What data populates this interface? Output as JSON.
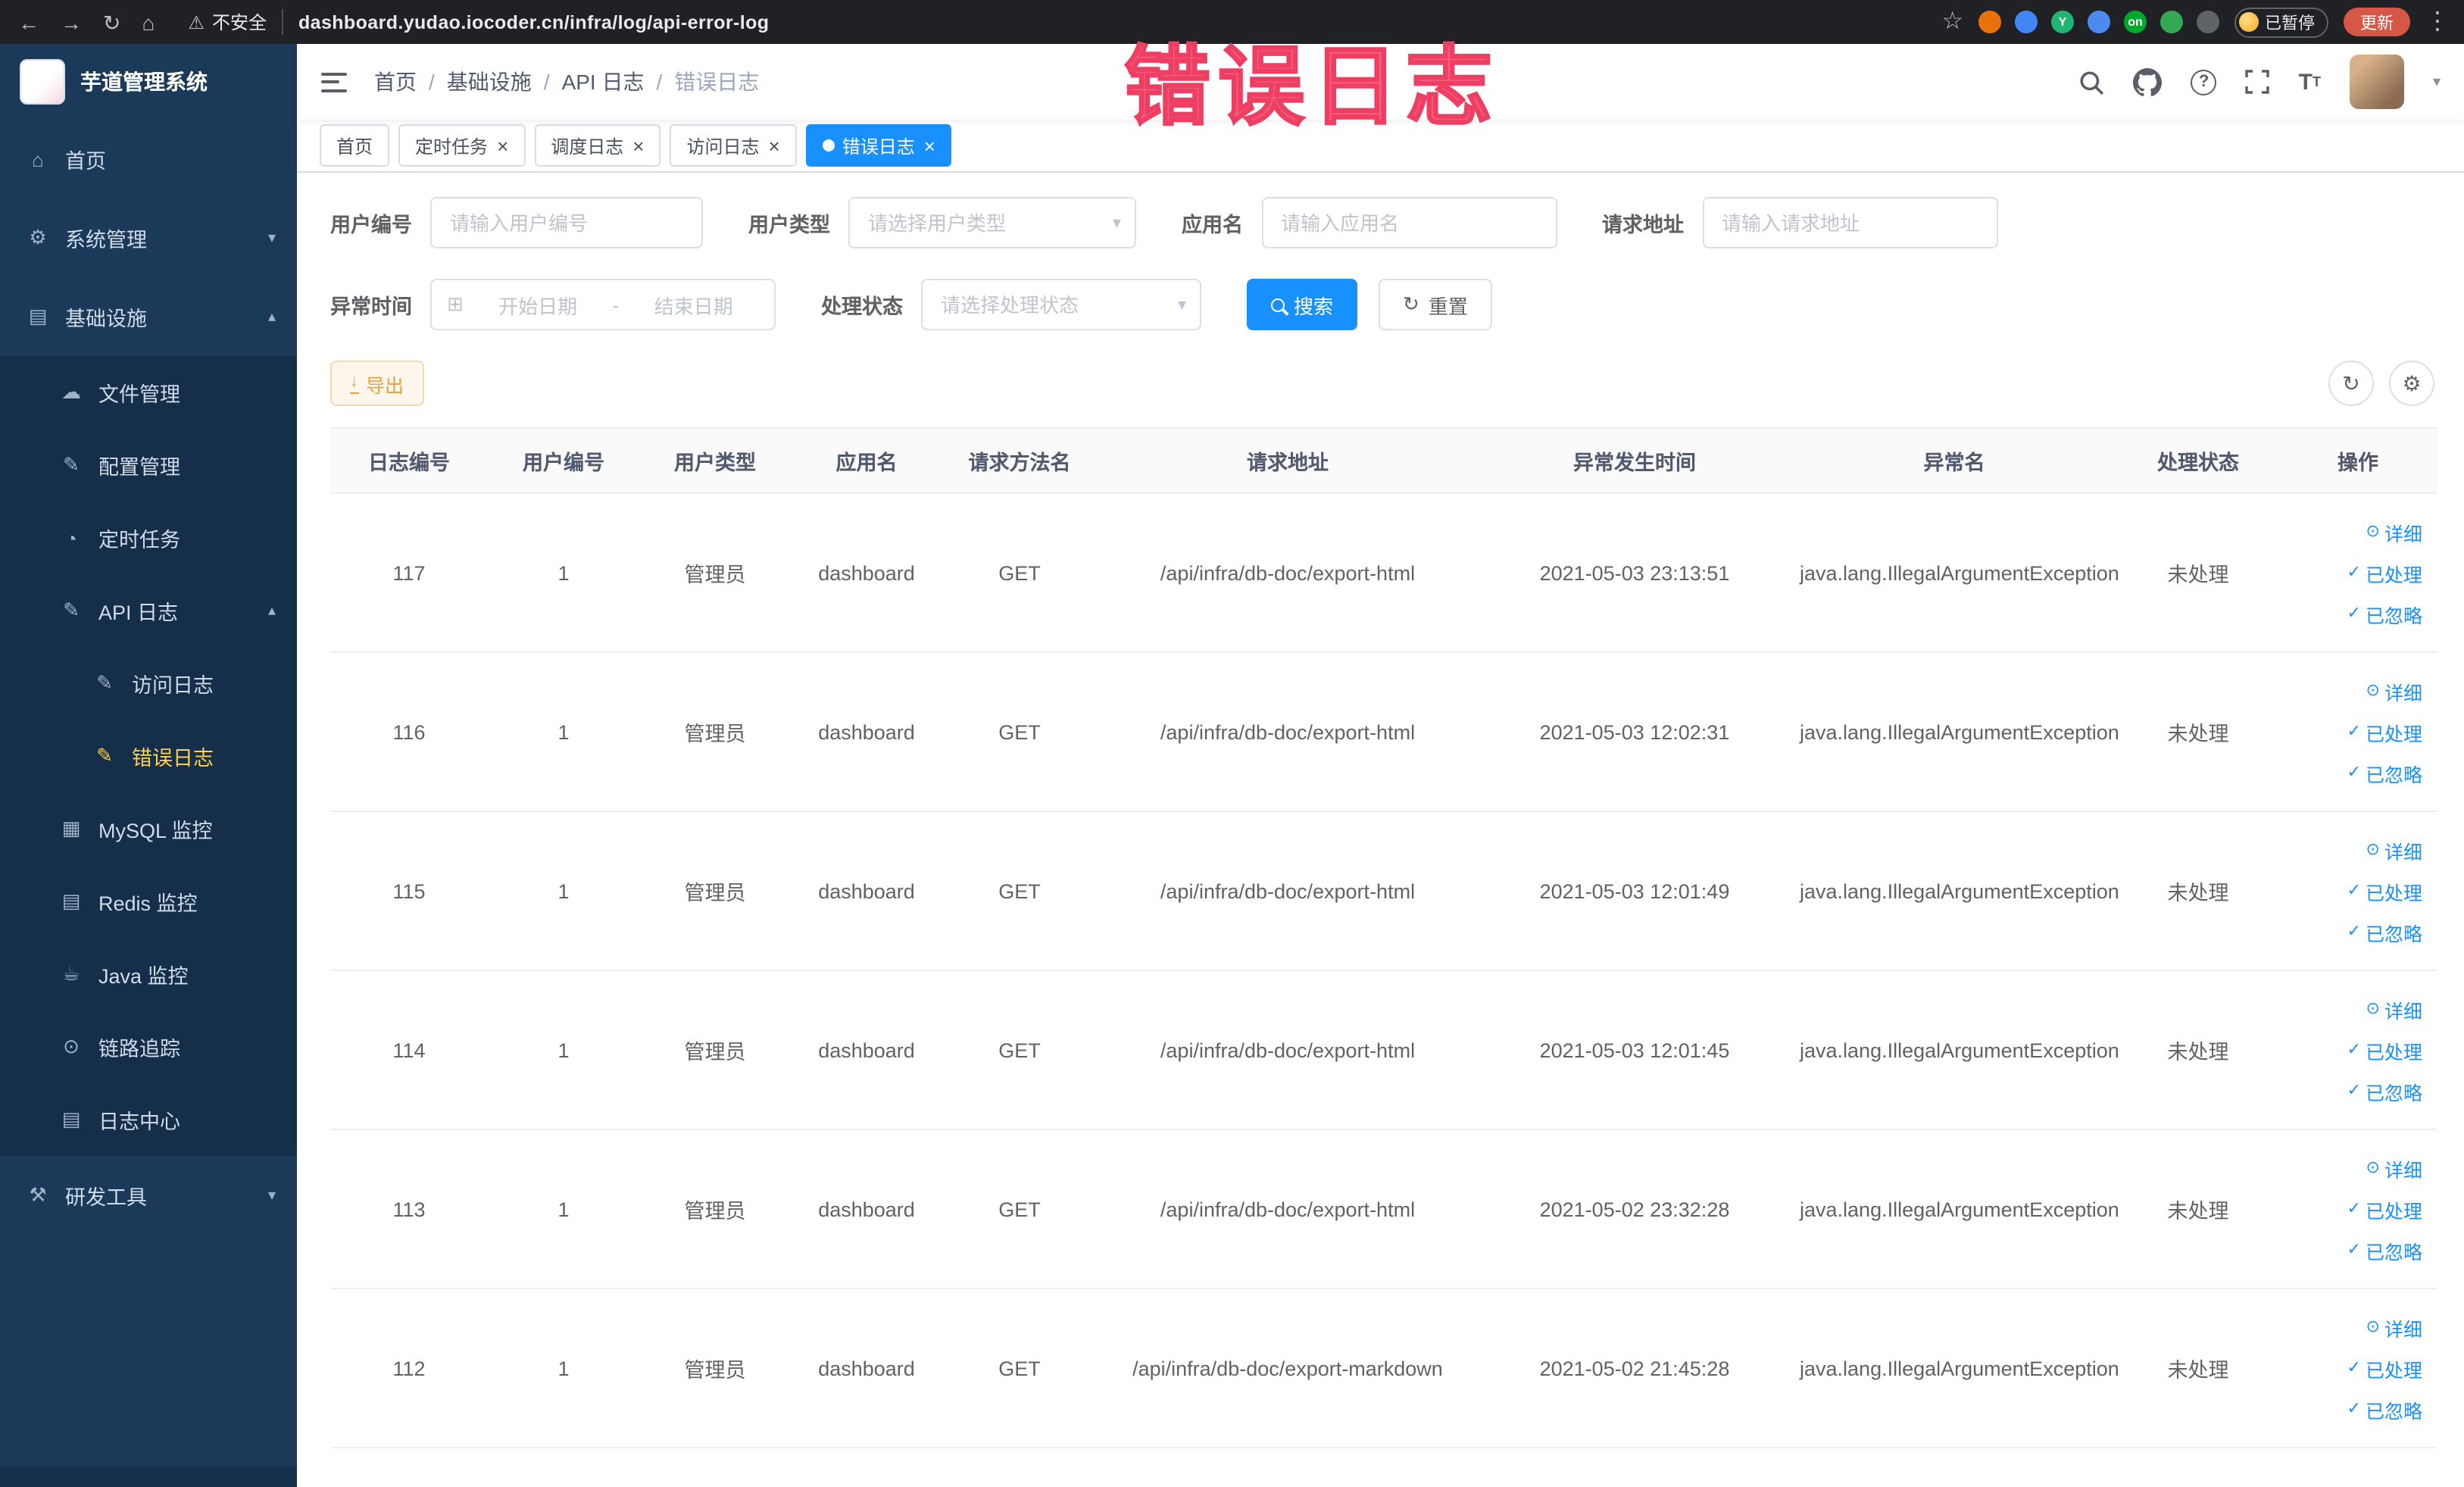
{
  "browser": {
    "security_label": "不安全",
    "url": "dashboard.yudao.iocoder.cn/infra/log/api-error-log",
    "paused_label": "已暂停",
    "update_label": "更新",
    "extensions": [
      {
        "name": "ext-orange",
        "color": "#e8710a"
      },
      {
        "name": "ext-blue",
        "color": "#4285f4"
      },
      {
        "name": "ext-green",
        "color": "#21b573",
        "label": "Y"
      },
      {
        "name": "ext-grid",
        "color": "#4d8af0"
      },
      {
        "name": "ext-switch",
        "color": "#00a82d",
        "label": "on"
      },
      {
        "name": "ext-leaf",
        "color": "#34a853"
      },
      {
        "name": "ext-dark",
        "color": "#5f6368"
      }
    ]
  },
  "annotation": {
    "text": "错误日志"
  },
  "sidebar": {
    "logo_title": "芋道管理系统",
    "items": [
      {
        "label": "首页",
        "icon": "home-icon",
        "level": 1
      },
      {
        "label": "系统管理",
        "icon": "gear-icon",
        "level": 1,
        "arrow": "down"
      },
      {
        "label": "基础设施",
        "icon": "infra-icon",
        "level": 1,
        "arrow": "up"
      },
      {
        "label": "文件管理",
        "icon": "file-icon",
        "level": 2
      },
      {
        "label": "配置管理",
        "icon": "config-icon",
        "level": 2
      },
      {
        "label": "定时任务",
        "icon": "timer-icon",
        "level": 2
      },
      {
        "label": "API 日志",
        "icon": "api-log-icon",
        "level": 2,
        "arrow": "up"
      },
      {
        "label": "访问日志",
        "icon": "access-log-icon",
        "level": 3
      },
      {
        "label": "错误日志",
        "icon": "error-log-icon",
        "level": 3,
        "active": true
      },
      {
        "label": "MySQL 监控",
        "icon": "mysql-icon",
        "level": 2
      },
      {
        "label": "Redis 监控",
        "icon": "redis-icon",
        "level": 2
      },
      {
        "label": "Java 监控",
        "icon": "java-icon",
        "level": 2
      },
      {
        "label": "链路追踪",
        "icon": "trace-icon",
        "level": 2
      },
      {
        "label": "日志中心",
        "icon": "log-center-icon",
        "level": 2
      },
      {
        "label": "研发工具",
        "icon": "tools-icon",
        "level": 1,
        "arrow": "down"
      }
    ]
  },
  "header": {
    "breadcrumb": [
      "首页",
      "基础设施",
      "API 日志",
      "错误日志"
    ]
  },
  "tabs": [
    {
      "label": "首页"
    },
    {
      "label": "定时任务",
      "closable": true
    },
    {
      "label": "调度日志",
      "closable": true
    },
    {
      "label": "访问日志",
      "closable": true
    },
    {
      "label": "错误日志",
      "closable": true,
      "active": true
    }
  ],
  "filters": {
    "user_id": {
      "label": "用户编号",
      "placeholder": "请输入用户编号"
    },
    "user_type": {
      "label": "用户类型",
      "placeholder": "请选择用户类型"
    },
    "app_name": {
      "label": "应用名",
      "placeholder": "请输入应用名"
    },
    "request_url": {
      "label": "请求地址",
      "placeholder": "请输入请求地址"
    },
    "exception_time": {
      "label": "异常时间",
      "start_placeholder": "开始日期",
      "separator": "-",
      "end_placeholder": "结束日期"
    },
    "process_status": {
      "label": "处理状态",
      "placeholder": "请选择处理状态"
    },
    "search_label": "搜索",
    "reset_label": "重置"
  },
  "toolbar": {
    "export_label": "导出"
  },
  "table": {
    "columns": [
      "日志编号",
      "用户编号",
      "用户类型",
      "应用名",
      "请求方法名",
      "请求地址",
      "异常发生时间",
      "异常名",
      "处理状态",
      "操作"
    ],
    "action_labels": [
      "详细",
      "已处理",
      "已忽略"
    ],
    "rows": [
      {
        "id": "117",
        "user_id": "1",
        "user_type": "管理员",
        "app_name": "dashboard",
        "method": "GET",
        "url": "/api/infra/db-doc/export-html",
        "time": "2021-05-03 23:13:51",
        "exception": "java.lang.IllegalArgumentException",
        "status": "未处理"
      },
      {
        "id": "116",
        "user_id": "1",
        "user_type": "管理员",
        "app_name": "dashboard",
        "method": "GET",
        "url": "/api/infra/db-doc/export-html",
        "time": "2021-05-03 12:02:31",
        "exception": "java.lang.IllegalArgumentException",
        "status": "未处理"
      },
      {
        "id": "115",
        "user_id": "1",
        "user_type": "管理员",
        "app_name": "dashboard",
        "method": "GET",
        "url": "/api/infra/db-doc/export-html",
        "time": "2021-05-03 12:01:49",
        "exception": "java.lang.IllegalArgumentException",
        "status": "未处理"
      },
      {
        "id": "114",
        "user_id": "1",
        "user_type": "管理员",
        "app_name": "dashboard",
        "method": "GET",
        "url": "/api/infra/db-doc/export-html",
        "time": "2021-05-03 12:01:45",
        "exception": "java.lang.IllegalArgumentException",
        "status": "未处理"
      },
      {
        "id": "113",
        "user_id": "1",
        "user_type": "管理员",
        "app_name": "dashboard",
        "method": "GET",
        "url": "/api/infra/db-doc/export-html",
        "time": "2021-05-02 23:32:28",
        "exception": "java.lang.IllegalArgumentException",
        "status": "未处理"
      },
      {
        "id": "112",
        "user_id": "1",
        "user_type": "管理员",
        "app_name": "dashboard",
        "method": "GET",
        "url": "/api/infra/db-doc/export-markdown",
        "time": "2021-05-02 21:45:28",
        "exception": "java.lang.IllegalArgumentException",
        "status": "未处理"
      }
    ]
  },
  "colors": {
    "accent": "#1890ff",
    "sidebar_active": "#ffd04b",
    "warning": "#e6a23c",
    "annotation": "#f4607d"
  }
}
